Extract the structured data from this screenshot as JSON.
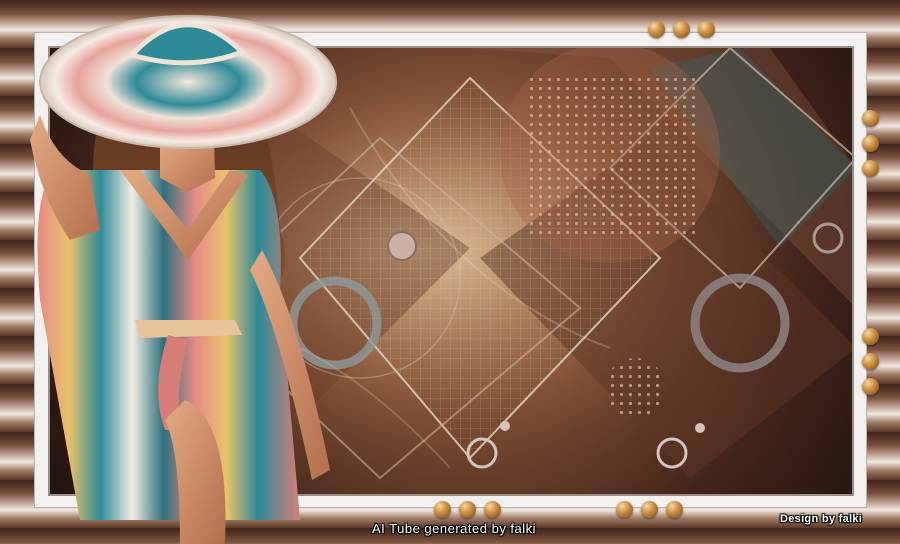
{
  "caption": "AI Tube generated by falki",
  "signature": "Design by falki",
  "colors": {
    "frame_light": "#f3f1ef",
    "bead_gold": "#c88a3e",
    "scene_dark": "#3f2419",
    "scene_warm": "#b78e6a",
    "dress_teal": "#2e8a97",
    "dress_pink": "#e58b86",
    "dress_yellow": "#e9c26b",
    "hair_brown": "#4d2a18",
    "skin": "#d79a72"
  }
}
